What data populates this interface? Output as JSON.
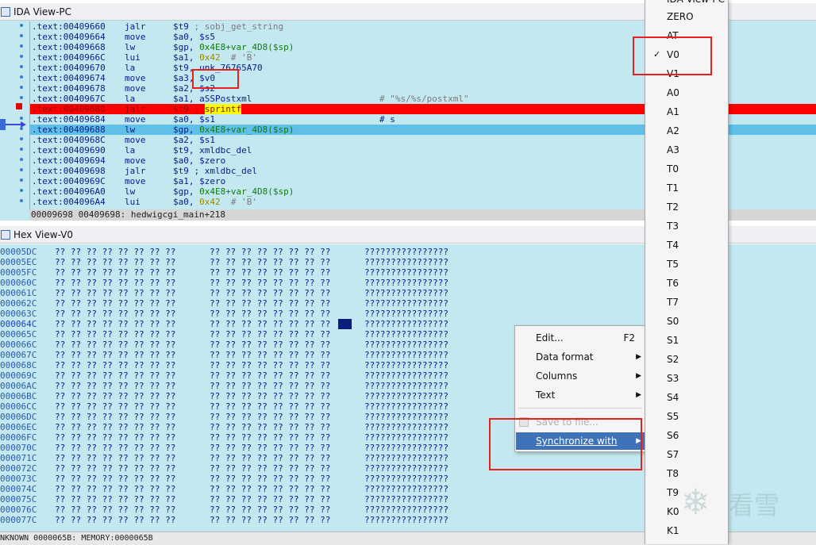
{
  "ida_view": {
    "title": "IDA View-PC",
    "lines": [
      {
        "addr": ".text:00409660",
        "mnem": "jalr",
        "ops": "$t9 ; sobj_get_string",
        "comment": ""
      },
      {
        "addr": ".text:00409664",
        "mnem": "move",
        "ops": "$a0, $s5",
        "comment": ""
      },
      {
        "addr": ".text:00409668",
        "mnem": "lw",
        "ops": "$gp, 0x4E8+var_4D8($sp)",
        "comment": ""
      },
      {
        "addr": ".text:0040966C",
        "mnem": "lui",
        "ops": "$a1, 0x42  # 'B'",
        "comment": ""
      },
      {
        "addr": ".text:00409670",
        "mnem": "la",
        "ops": "$t9, unk_76765A70",
        "comment": ""
      },
      {
        "addr": ".text:00409674",
        "mnem": "move",
        "ops": "$a3, $v0",
        "comment": ""
      },
      {
        "addr": ".text:00409678",
        "mnem": "move",
        "ops": "$a2, $s2",
        "comment": ""
      },
      {
        "addr": ".text:0040967C",
        "mnem": "la",
        "ops": "$a1, aSSPostxml",
        "comment": "# \"%s/%s/postxml\""
      },
      {
        "addr": ".text:00409680",
        "mnem": "jalr",
        "ops": "$t9 ; sprintf",
        "comment": ""
      },
      {
        "addr": ".text:00409684",
        "mnem": "move",
        "ops": "$a0, $s1",
        "comment": "# s"
      },
      {
        "addr": ".text:00409688",
        "mnem": "lw",
        "ops": "$gp, 0x4E8+var_4D8($sp)",
        "comment": ""
      },
      {
        "addr": ".text:0040968C",
        "mnem": "move",
        "ops": "$a2, $s1",
        "comment": ""
      },
      {
        "addr": ".text:00409690",
        "mnem": "la",
        "ops": "$t9, xmldbc_del",
        "comment": ""
      },
      {
        "addr": ".text:00409694",
        "mnem": "move",
        "ops": "$a0, $zero",
        "comment": ""
      },
      {
        "addr": ".text:00409698",
        "mnem": "jalr",
        "ops": "$t9 ; xmldbc_del",
        "comment": ""
      },
      {
        "addr": ".text:0040969C",
        "mnem": "move",
        "ops": "$a1, $zero",
        "comment": ""
      },
      {
        "addr": ".text:004096A0",
        "mnem": "lw",
        "ops": "$gp, 0x4E8+var_4D8($sp)",
        "comment": ""
      },
      {
        "addr": ".text:004096A4",
        "mnem": "lui",
        "ops": "$a0, 0x42  # 'B'",
        "comment": ""
      }
    ],
    "status": "00009698 00409698: hedwigcgi_main+218"
  },
  "hex_view": {
    "title": "Hex View-V0",
    "bytes_group": "?? ?? ?? ?? ?? ?? ?? ??",
    "ascii": "????????????????",
    "rows": [
      "00005DC",
      "00005EC",
      "00005FC",
      "000060C",
      "000061C",
      "000062C",
      "000063C",
      "000064C",
      "000065C",
      "000066C",
      "000067C",
      "000068C",
      "000069C",
      "00006AC",
      "00006BC",
      "00006CC",
      "00006DC",
      "00006EC",
      "00006FC",
      "000070C",
      "000071C",
      "000072C",
      "000073C",
      "000074C",
      "000075C",
      "000076C",
      "000077C"
    ],
    "selected_row": "000064C"
  },
  "status_bar": "NKNOWN 0000065B: MEMORY:0000065B",
  "context_menu": {
    "items": [
      {
        "label": "Edit...",
        "shortcut": "F2"
      },
      {
        "label": "Data format"
      },
      {
        "label": "Columns"
      },
      {
        "label": "Text"
      },
      {
        "label": "Save to file..."
      },
      {
        "label": "Synchronize with"
      }
    ]
  },
  "register_menu": {
    "top_item": "IDA View-PC",
    "checked": "V0",
    "items": [
      "ZERO",
      "AT",
      "V0",
      "V1",
      "A0",
      "A1",
      "A2",
      "A3",
      "T0",
      "T1",
      "T2",
      "T3",
      "T4",
      "T5",
      "T6",
      "T7",
      "S0",
      "S1",
      "S2",
      "S3",
      "S4",
      "S5",
      "S6",
      "S7",
      "T8",
      "T9",
      "K0",
      "K1"
    ]
  },
  "watermark": "看雪",
  "colors": {
    "pane_bg": "#c4e8f0",
    "breakpoint": "#ff0000",
    "current_line": "#5fbfe8",
    "annotation": "#e52020"
  }
}
